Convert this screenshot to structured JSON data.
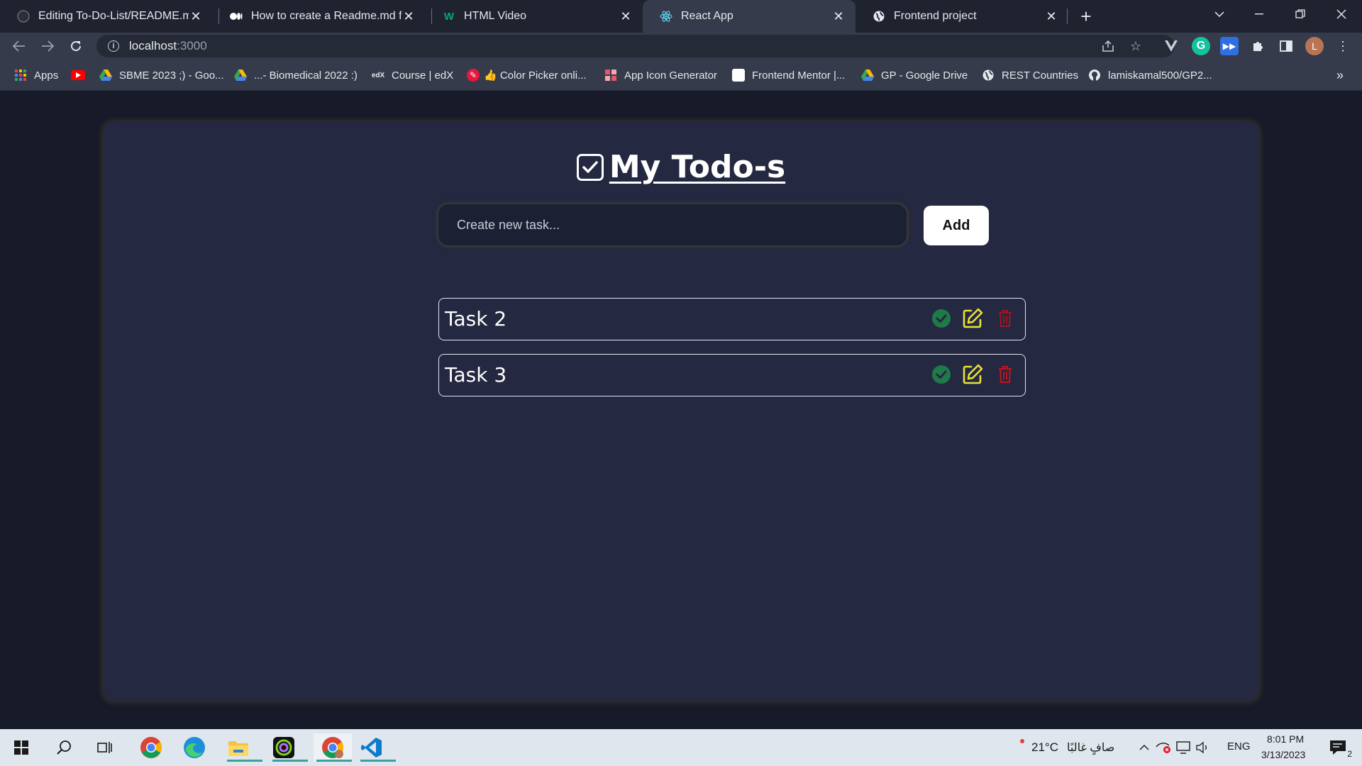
{
  "browser": {
    "tabs": [
      {
        "title": "Editing To-Do-List/README.md a",
        "icon": "github-icon",
        "active": false
      },
      {
        "title": "How to create a Readme.md file?",
        "icon": "medium-icon",
        "active": false
      },
      {
        "title": "HTML Video",
        "icon": "w3schools-icon",
        "active": false
      },
      {
        "title": "React App",
        "icon": "react-icon",
        "active": true
      },
      {
        "title": "Frontend project",
        "icon": "globe-icon",
        "active": false
      }
    ],
    "new_tab": "+",
    "address": {
      "host": "localhost",
      "port": ":3000"
    },
    "bookmarks": [
      {
        "label": "Apps",
        "icon": "apps-grid-icon"
      },
      {
        "label": "",
        "icon": "youtube-icon"
      },
      {
        "label": "SBME 2023 ;) - Goo...",
        "icon": "google-drive-icon"
      },
      {
        "label": "...- Biomedical 2022 :)",
        "icon": "google-drive-icon"
      },
      {
        "label": "Course | edX",
        "icon": "edx-icon"
      },
      {
        "label": "",
        "icon": "color-picker-icon"
      },
      {
        "label": "👍 Color Picker onli...",
        "icon": ""
      },
      {
        "label": "App Icon Generator",
        "icon": "app-icon-generator-icon"
      },
      {
        "label": "Frontend Mentor |...",
        "icon": "frontend-mentor-icon"
      },
      {
        "label": "GP - Google Drive",
        "icon": "google-drive-icon"
      },
      {
        "label": "REST Countries",
        "icon": "globe-icon"
      },
      {
        "label": "lamiskamal500/GP2...",
        "icon": "github-icon"
      }
    ],
    "profile_initial": "L",
    "bookmarks_overflow": "»"
  },
  "app": {
    "title": "My Todo-s",
    "input_placeholder": "Create new task...",
    "add_label": "Add",
    "tasks": [
      {
        "name": "Task 2"
      },
      {
        "name": "Task 3"
      }
    ],
    "colors": {
      "complete": "#1f7a49",
      "edit": "#e8e13a",
      "delete": "#a3151e",
      "card": "#242840",
      "background": "#161a29"
    }
  },
  "taskbar": {
    "weather": "21°C",
    "weather_desc": "صافٍ غالبًا",
    "language": "ENG",
    "time": "8:01 PM",
    "date": "3/13/2023",
    "notifications": "2"
  }
}
